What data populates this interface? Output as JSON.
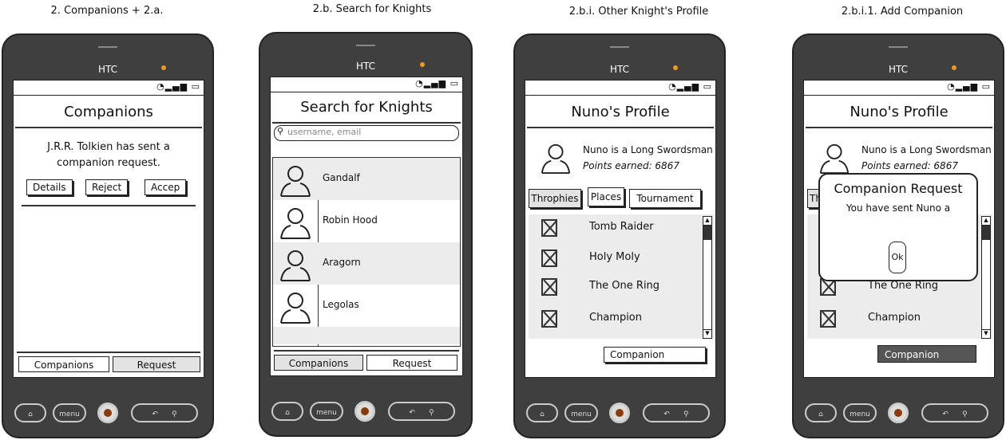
{
  "captions": [
    "2. Companions + 2.a.",
    "2.b. Search for Knights",
    "2.b.i. Other Knight's Profile",
    "2.b.i.1. Add Companion"
  ],
  "phone": {
    "brand": "HTC",
    "status_icons": "◔▂▄▆ ▭",
    "hw_menu": "menu"
  },
  "screen1": {
    "title": "Companions",
    "message": "J.R.R. Tolkien has sent a companion request.",
    "buttons": [
      "Details",
      "Reject",
      "Accep"
    ],
    "tabs": [
      "Companions",
      "Request"
    ]
  },
  "screen2": {
    "title": "Search for Knights",
    "search_placeholder": "username, email",
    "knights": [
      "Gandalf",
      "Robin Hood",
      "Aragorn",
      "Legolas"
    ],
    "tabs": [
      "Companions",
      "Request"
    ]
  },
  "screen3": {
    "title": "Nuno's Profile",
    "bio": "Nuno is a Long Swordsman",
    "points": "Points earned: 6867",
    "tabs": [
      "Throphies",
      "Places",
      "Tournament"
    ],
    "trophies": [
      "Tomb Raider",
      "Holy Moly",
      "The One Ring",
      "Champion"
    ],
    "companion_button": "Companion"
  },
  "screen4": {
    "title": "Nuno's Profile",
    "bio": "Nuno is a Long Swordsman",
    "points": "Points earned: 6867",
    "tab_partial": "Th",
    "trophies_visible": [
      "The One Ring",
      "Champion"
    ],
    "companion_button": "Companion",
    "dialog": {
      "title": "Companion Request",
      "message": "You have sent Nuno a",
      "ok": "Ok"
    }
  }
}
